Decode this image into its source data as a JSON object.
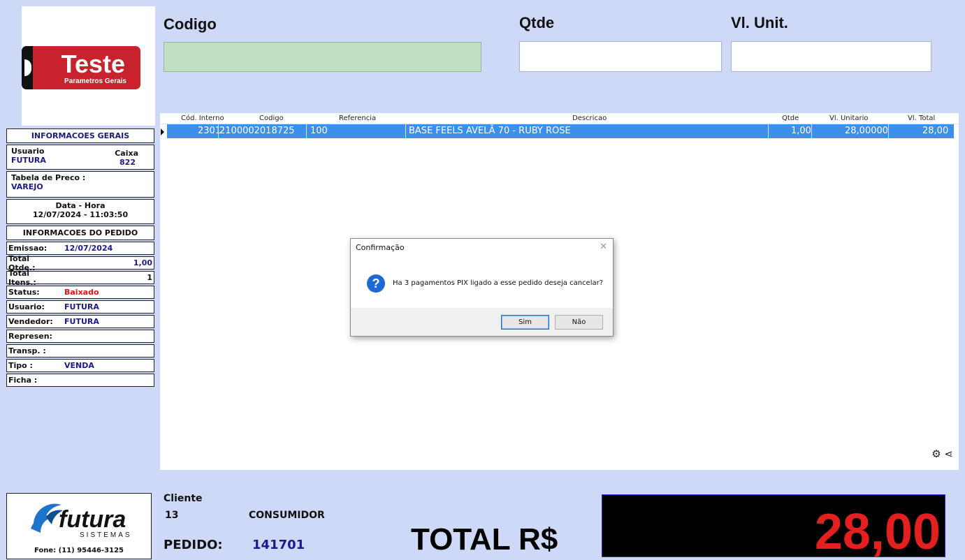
{
  "logo": {
    "title": "Teste",
    "subtitle": "Parametros Gerais"
  },
  "fields": {
    "codigo_label": "Codigo",
    "qtde_label": "Qtde",
    "vlunit_label": "Vl. Unit."
  },
  "info_geral": {
    "title": "INFORMACOES GERAIS",
    "usuario_label": "Usuario",
    "usuario_value": "FUTURA",
    "caixa_label": "Caixa",
    "caixa_value": "822",
    "tabela_label": "Tabela de Preco :",
    "tabela_value": "VAREJO",
    "datahora_label": "Data - Hora",
    "datahora_value": "12/07/2024 - 11:03:50"
  },
  "info_pedido": {
    "title": "INFORMACOES DO PEDIDO",
    "emissao_label": "Emissao:",
    "emissao_value": "12/07/2024",
    "total_qtde_label": "Total Qtde.:",
    "total_qtde_value": "1,00",
    "total_itens_label": "Total Itens.:",
    "total_itens_value": "1",
    "status_label": "Status:",
    "status_value": "Baixado",
    "usuario_label": "Usuario:",
    "usuario_value": "FUTURA",
    "vendedor_label": "Vendedor:",
    "vendedor_value": "FUTURA",
    "represen_label": "Represen:",
    "transp_label": "Transp. :",
    "tipo_label": "Tipo :",
    "tipo_value": "VENDA",
    "ficha_label": "Ficha :"
  },
  "grid": {
    "headers": [
      "Cód. Interno",
      "Codigo",
      "Referencia",
      "Descricao",
      "Qtde",
      "Vl. Unitario",
      "Vl. Total"
    ],
    "row": {
      "cod_interno": "2301",
      "codigo": "2100002018725",
      "referencia": "100",
      "descricao": "BASE FEELS AVELÃ 70 - RUBY ROSE",
      "qtde": "1,00",
      "vl_unitario": "28,00000",
      "vl_total": "28,00"
    }
  },
  "dialog": {
    "title": "Confirmação",
    "message": "Ha 3 pagamentos PIX ligado a esse pedido deseja cancelar?",
    "yes": "Sim",
    "no": "Não"
  },
  "footer": {
    "fone": "Fone: (11) 95446-3125",
    "futura_text": "futura",
    "futura_sub": "SISTEMAS",
    "cliente_label": "Cliente",
    "cliente_code": "13",
    "cliente_name": "CONSUMIDOR",
    "pedido_label": "PEDIDO:",
    "pedido_value": "141701",
    "total_label": "TOTAL R$",
    "total_value": "28,00"
  },
  "colors": {
    "background": "#cdd9f6",
    "selected_row": "#3e8fe9",
    "total": "#e31f1f",
    "accent_blue": "#1c1a88"
  }
}
